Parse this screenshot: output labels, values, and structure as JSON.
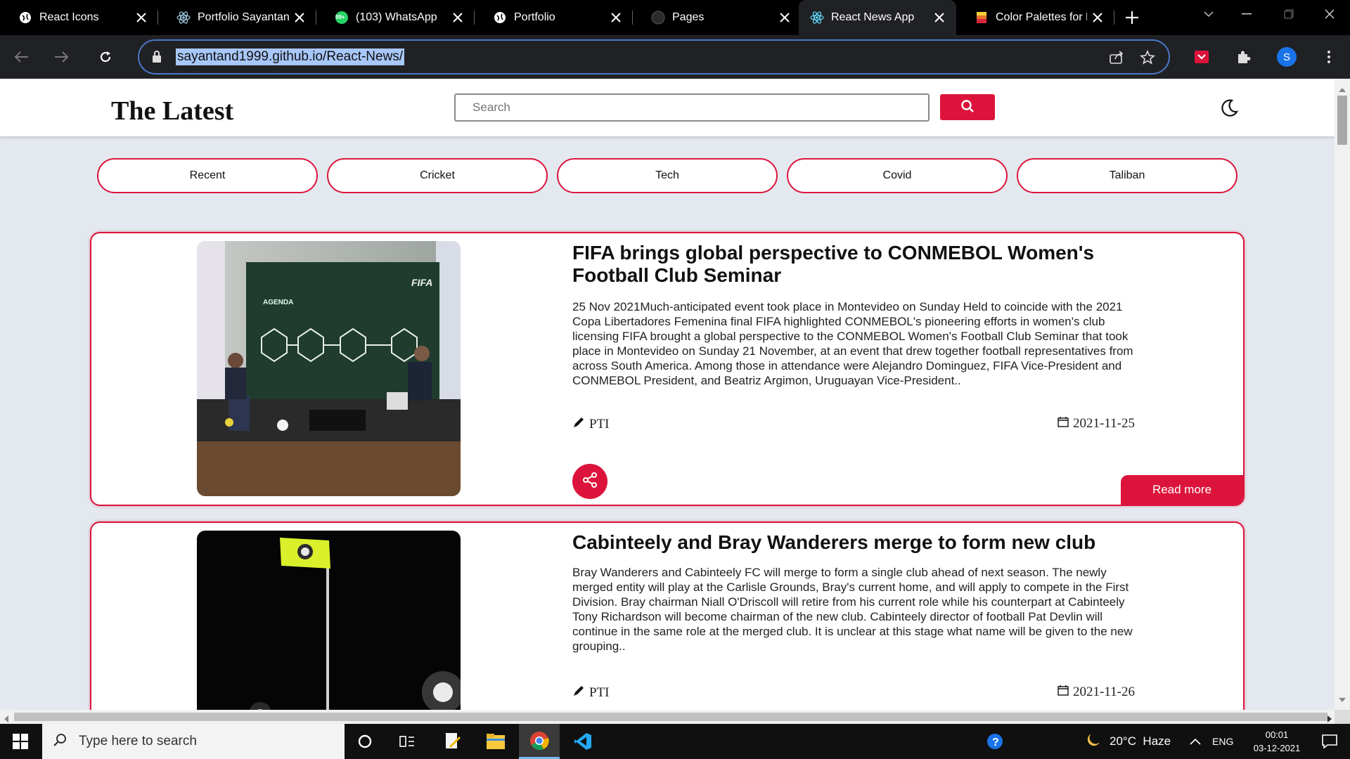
{
  "browser": {
    "tabs": [
      {
        "label": "React Icons",
        "icon": "globe-icon"
      },
      {
        "label": "Portfolio Sayantan D",
        "icon": "react-icon"
      },
      {
        "label": "(103) WhatsApp",
        "icon": "whatsapp-icon"
      },
      {
        "label": "Portfolio",
        "icon": "globe-icon"
      },
      {
        "label": "Pages",
        "icon": "github-icon"
      },
      {
        "label": "React News App",
        "icon": "react-icon"
      },
      {
        "label": "Color Palettes for D",
        "icon": "palette-icon"
      }
    ],
    "active_tab_index": 5,
    "whatsapp_badge": "99+",
    "url": "sayantand1999.github.io/React-News/",
    "profile_initial": "S"
  },
  "app": {
    "brand": "The Latest",
    "search": {
      "placeholder": "Search"
    },
    "categories": [
      "Recent",
      "Cricket",
      "Tech",
      "Covid",
      "Taliban"
    ],
    "articles": [
      {
        "title": "FIFA brings global perspective to CONMEBOL Women's Football Club Seminar",
        "description": "25 Nov 2021Much-anticipated event took place in Montevideo on Sunday Held to coincide with the 2021 Copa Libertadores Femenina final FIFA highlighted CONMEBOL's pioneering efforts in women's club licensing FIFA brought a global perspective to the CONMEBOL Women's Football Club Seminar that took place in Montevideo on Sunday 21 November, at an event that drew together football representatives from across South America. Among those in attendance were Alejandro Dominguez, FIFA Vice-President and CONMEBOL President, and Beatriz Argimon, Uruguayan Vice-President..",
        "source": "PTI",
        "date": "2021-11-25",
        "read_more": "Read more",
        "image_text": {
          "banner": "FIFA",
          "agenda": "AGENDA"
        }
      },
      {
        "title": "Cabinteely and Bray Wanderers merge to form new club",
        "description": "Bray Wanderers and Cabinteely FC will merge to form a single club ahead of next season. The newly merged entity will play at the Carlisle Grounds, Bray's current home, and will apply to compete in the First Division. Bray chairman Niall O'Driscoll will retire from his current role while his counterpart at Cabinteely Tony Richardson will become chairman of the new club. Cabinteely director of football Pat Devlin will continue in the same role at the merged club. It is unclear at this stage what name will be given to the new grouping..",
        "source": "PTI",
        "date": "2021-11-26"
      }
    ]
  },
  "taskbar": {
    "search_placeholder": "Type here to search",
    "weather": "20°C  Haze",
    "language": "ENG",
    "time": "00:01",
    "date": "03-12-2021"
  },
  "colors": {
    "accent": "#dc143c",
    "page_bg": "#e3e9ef"
  }
}
